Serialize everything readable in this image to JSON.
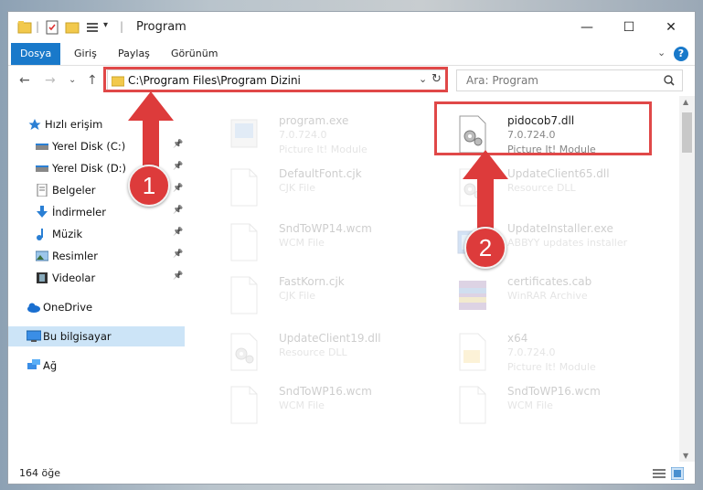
{
  "window": {
    "title": "Program",
    "controls": {
      "minimize": "—",
      "maximize": "☐",
      "close": "✕"
    }
  },
  "ribbon": {
    "tabs": [
      "Dosya",
      "Giriş",
      "Paylaş",
      "Görünüm"
    ],
    "help": "?"
  },
  "address_bar": {
    "path": "C:\\Program Files\\Program Dizini",
    "search_placeholder": "Ara: Program"
  },
  "sidebar": {
    "items": [
      {
        "label": "Hızlı erişim",
        "icon": "star-icon",
        "pinned": false
      },
      {
        "label": "Yerel Disk (C:)",
        "icon": "drive-icon",
        "pinned": true
      },
      {
        "label": "Yerel Disk (D:)",
        "icon": "drive-icon",
        "pinned": true
      },
      {
        "label": "Belgeler",
        "icon": "documents-icon",
        "pinned": true
      },
      {
        "label": "İndirmeler",
        "icon": "download-icon",
        "pinned": true
      },
      {
        "label": "Müzik",
        "icon": "music-icon",
        "pinned": true
      },
      {
        "label": "Resimler",
        "icon": "pictures-icon",
        "pinned": true
      },
      {
        "label": "Videolar",
        "icon": "videos-icon",
        "pinned": true
      },
      {
        "label": "OneDrive",
        "icon": "cloud-icon",
        "pinned": false
      },
      {
        "label": "Bu bilgisayar",
        "icon": "computer-icon",
        "pinned": false
      },
      {
        "label": "Ağ",
        "icon": "network-icon",
        "pinned": false
      }
    ]
  },
  "files": [
    {
      "name": "program.exe",
      "line2": "7.0.724.0",
      "line3": "Picture It! Module",
      "icon": "exe-icon",
      "faded": true
    },
    {
      "name": "pidocob7.dll",
      "line2": "7.0.724.0",
      "line3": "Picture It! Module",
      "icon": "dll-icon",
      "faded": false
    },
    {
      "name": "DefaultFont.cjk",
      "line2": "CJK File",
      "line3": "",
      "icon": "file-icon",
      "faded": true
    },
    {
      "name": "UpdateClient65.dll",
      "line2": "Resource DLL",
      "line3": "",
      "icon": "dll-icon",
      "faded": true
    },
    {
      "name": "SndToWP14.wcm",
      "line2": "WCM File",
      "line3": "",
      "icon": "file-icon",
      "faded": true
    },
    {
      "name": "UpdateInstaller.exe",
      "line2": "ABBYY updates installer",
      "line3": "",
      "icon": "installer-icon",
      "faded": true
    },
    {
      "name": "FastKorn.cjk",
      "line2": "CJK File",
      "line3": "",
      "icon": "file-icon",
      "faded": true
    },
    {
      "name": "certificates.cab",
      "line2": "WinRAR Archive",
      "line3": "",
      "icon": "archive-icon",
      "faded": true
    },
    {
      "name": "UpdateClient19.dll",
      "line2": "Resource DLL",
      "line3": "",
      "icon": "dll-icon",
      "faded": true
    },
    {
      "name": "x64",
      "line2": "7.0.724.0",
      "line3": "Picture It! Module",
      "icon": "folder-file-icon",
      "faded": true
    },
    {
      "name": "SndToWP16.wcm",
      "line2": "WCM File",
      "line3": "",
      "icon": "file-icon",
      "faded": true
    },
    {
      "name": "SndToWP16.wcm",
      "line2": "WCM File",
      "line3": "",
      "icon": "file-icon",
      "faded": true
    }
  ],
  "status": {
    "item_count": "164 öğe"
  },
  "annotations": {
    "marker1": "1",
    "marker2": "2"
  },
  "colors": {
    "accent": "#1979ca",
    "annotation_red": "#e04848",
    "selected": "#cce4f7"
  }
}
